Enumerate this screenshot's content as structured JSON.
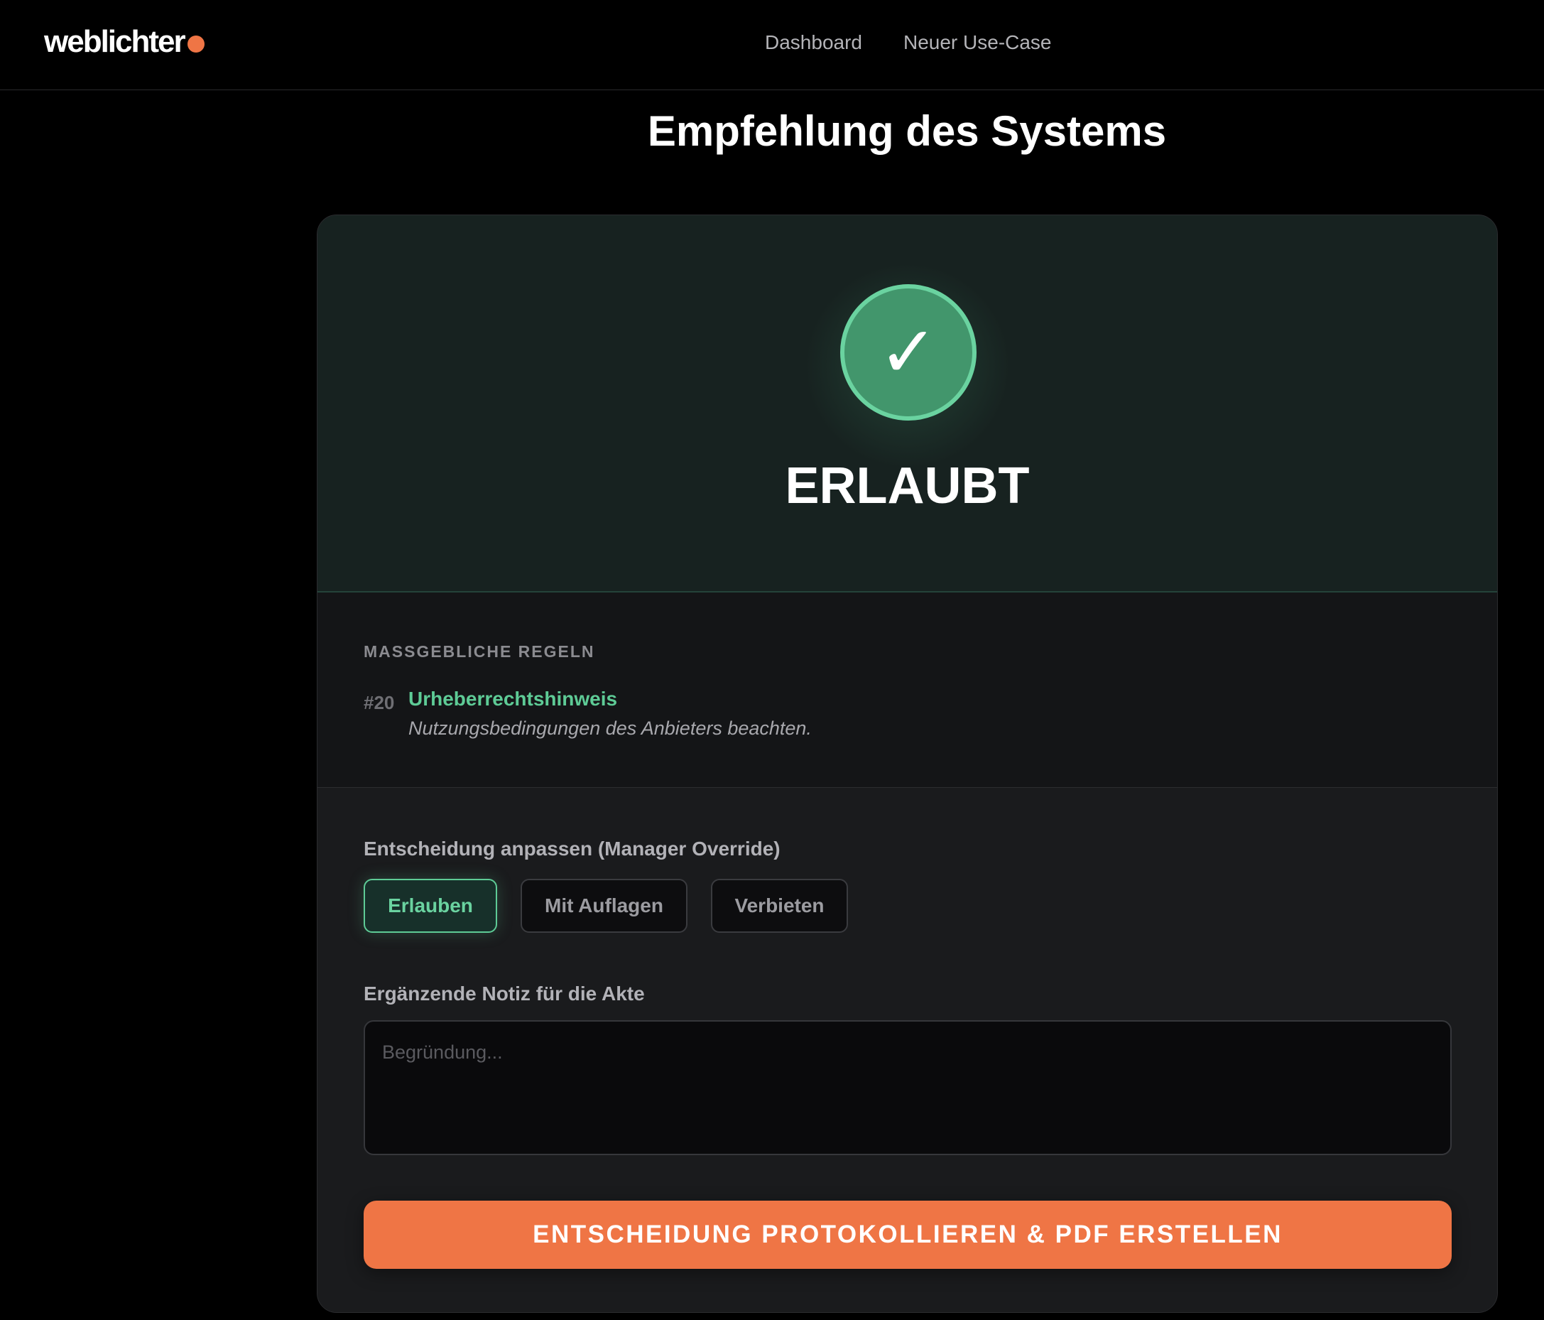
{
  "header": {
    "logo_text": "weblichter",
    "brand_color": "#ef7545",
    "nav": [
      {
        "label": "Dashboard"
      },
      {
        "label": "Neuer Use-Case"
      }
    ]
  },
  "page": {
    "title": "Empfehlung des Systems"
  },
  "verdict": {
    "icon": "checkmark-icon",
    "symbol": "✓",
    "label": "ERLAUBT",
    "color": "#42966c"
  },
  "rules": {
    "heading": "MASSGEBLICHE REGELN",
    "items": [
      {
        "id": "#20",
        "title": "Urheberrechtshinweis",
        "description": "Nutzungsbedingungen des Anbieters beachten."
      }
    ]
  },
  "override": {
    "label": "Entscheidung anpassen (Manager Override)",
    "options": [
      {
        "label": "Erlauben",
        "selected": true
      },
      {
        "label": "Mit Auflagen",
        "selected": false
      },
      {
        "label": "Verbieten",
        "selected": false
      }
    ],
    "note_label": "Ergänzende Notiz für die Akte",
    "note_placeholder": "Begründung...",
    "note_value": "",
    "submit_label": "ENTSCHEIDUNG PROTOKOLLIEREN & PDF ERSTELLEN",
    "submit_color": "#ef7545"
  }
}
